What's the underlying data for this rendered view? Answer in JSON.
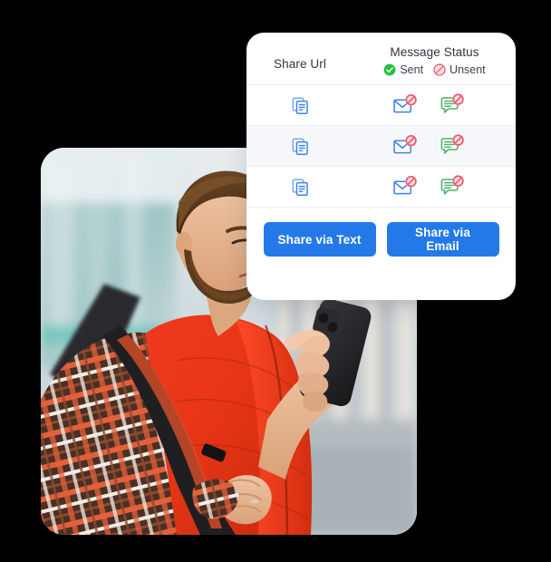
{
  "card": {
    "columns": {
      "share_url": "Share Url",
      "message_status": "Message Status"
    },
    "legend": [
      {
        "icon": "check-circle-icon",
        "label": "Sent",
        "color": "#26c03f"
      },
      {
        "icon": "blocked-circle-icon",
        "label": "Unsent",
        "color": "#f4566a"
      }
    ],
    "rows": [
      {
        "copy_icon": "copy-icon",
        "email_icon": "email-unsent-icon",
        "sms_icon": "sms-unsent-icon",
        "email_state": "Unsent",
        "sms_state": "Unsent"
      },
      {
        "copy_icon": "copy-icon",
        "email_icon": "email-unsent-icon",
        "sms_icon": "sms-unsent-icon",
        "email_state": "Unsent",
        "sms_state": "Unsent"
      },
      {
        "copy_icon": "copy-icon",
        "email_icon": "email-unsent-icon",
        "sms_icon": "sms-unsent-icon",
        "email_state": "Unsent",
        "sms_state": "Unsent"
      }
    ],
    "buttons": {
      "share_text": "Share via Text",
      "share_email": "Share via Email"
    },
    "colors": {
      "button_blue": "#2479e8",
      "copy_blue": "#4a90e8",
      "email_blue": "#3b82e8",
      "sms_green": "#4fb06a",
      "badge_red": "#f4566a",
      "sent_green": "#26c03f",
      "row_alt_bg": "#f6f8fc"
    }
  },
  "photo": {
    "alt": "Man with beard in red puffer vest and plaid shirt carrying a backpack, looking down at a black smartphone on a blurred city street"
  }
}
